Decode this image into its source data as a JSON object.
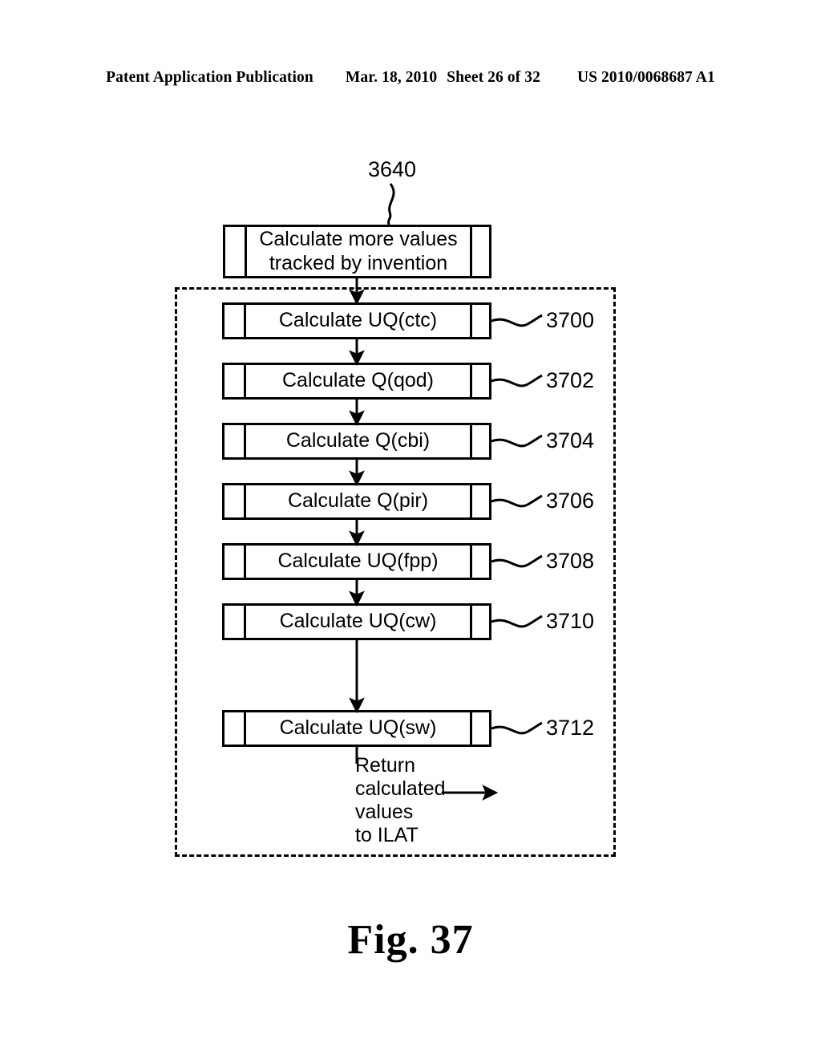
{
  "header": {
    "publication": "Patent Application Publication",
    "date": "Mar. 18, 2010",
    "sheet": "Sheet 26 of 32",
    "pub_number": "US 2010/0068687 A1"
  },
  "figure": {
    "caption": "Fig. 37",
    "top_ref": "3640",
    "top_box_label": "Calculate more values\ntracked by invention",
    "return_note": {
      "line1": "Return",
      "line2": "calculated",
      "line3": "values",
      "line4": "to ILAT",
      "arrow_icon": "right-arrow-icon"
    },
    "steps": [
      {
        "label": "Calculate UQ(ctc)",
        "ref": "3700"
      },
      {
        "label": "Calculate Q(qod)",
        "ref": "3702"
      },
      {
        "label": "Calculate Q(cbi)",
        "ref": "3704"
      },
      {
        "label": "Calculate Q(pir)",
        "ref": "3706"
      },
      {
        "label": "Calculate UQ(fpp)",
        "ref": "3708"
      },
      {
        "label": "Calculate UQ(cw)",
        "ref": "3710"
      },
      {
        "label": "Calculate UQ(sw)",
        "ref": "3712"
      }
    ],
    "colors": {
      "ink": "#000000",
      "paper": "#ffffff"
    }
  }
}
